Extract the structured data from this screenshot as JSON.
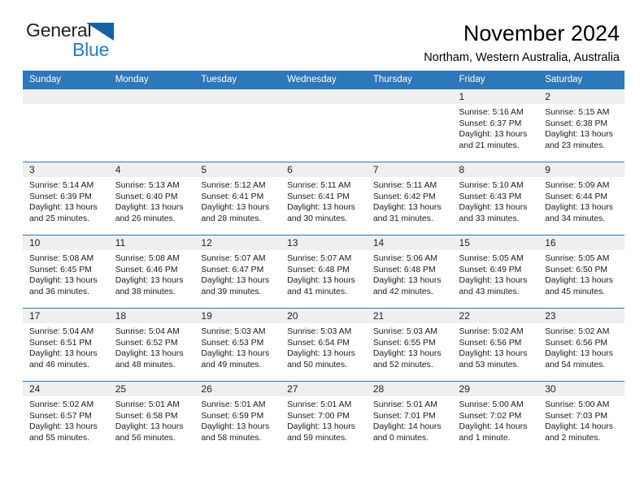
{
  "brand": {
    "word_general": "General",
    "word_blue": "Blue",
    "triangle_color": "#1464a5",
    "blue_text_color": "#1c7fd4"
  },
  "header": {
    "title": "November 2024",
    "location": "Northam, Western Australia, Australia"
  },
  "theme": {
    "header_blue": "#2e77b8",
    "daynum_band": "#efefef",
    "cell_background": "#ffffff",
    "text_color": "#1a1a1a"
  },
  "weekdays": [
    "Sunday",
    "Monday",
    "Tuesday",
    "Wednesday",
    "Thursday",
    "Friday",
    "Saturday"
  ],
  "labels": {
    "sunrise_prefix": "Sunrise:",
    "sunset_prefix": "Sunset:",
    "daylight_prefix": "Daylight:"
  },
  "weeks": [
    [
      {
        "day": "",
        "empty": true
      },
      {
        "day": "",
        "empty": true
      },
      {
        "day": "",
        "empty": true
      },
      {
        "day": "",
        "empty": true
      },
      {
        "day": "",
        "empty": true
      },
      {
        "day": "1",
        "sunrise": "Sunrise: 5:16 AM",
        "sunset": "Sunset: 6:37 PM",
        "daylight": "Daylight: 13 hours and 21 minutes."
      },
      {
        "day": "2",
        "sunrise": "Sunrise: 5:15 AM",
        "sunset": "Sunset: 6:38 PM",
        "daylight": "Daylight: 13 hours and 23 minutes."
      }
    ],
    [
      {
        "day": "3",
        "sunrise": "Sunrise: 5:14 AM",
        "sunset": "Sunset: 6:39 PM",
        "daylight": "Daylight: 13 hours and 25 minutes."
      },
      {
        "day": "4",
        "sunrise": "Sunrise: 5:13 AM",
        "sunset": "Sunset: 6:40 PM",
        "daylight": "Daylight: 13 hours and 26 minutes."
      },
      {
        "day": "5",
        "sunrise": "Sunrise: 5:12 AM",
        "sunset": "Sunset: 6:41 PM",
        "daylight": "Daylight: 13 hours and 28 minutes."
      },
      {
        "day": "6",
        "sunrise": "Sunrise: 5:11 AM",
        "sunset": "Sunset: 6:41 PM",
        "daylight": "Daylight: 13 hours and 30 minutes."
      },
      {
        "day": "7",
        "sunrise": "Sunrise: 5:11 AM",
        "sunset": "Sunset: 6:42 PM",
        "daylight": "Daylight: 13 hours and 31 minutes."
      },
      {
        "day": "8",
        "sunrise": "Sunrise: 5:10 AM",
        "sunset": "Sunset: 6:43 PM",
        "daylight": "Daylight: 13 hours and 33 minutes."
      },
      {
        "day": "9",
        "sunrise": "Sunrise: 5:09 AM",
        "sunset": "Sunset: 6:44 PM",
        "daylight": "Daylight: 13 hours and 34 minutes."
      }
    ],
    [
      {
        "day": "10",
        "sunrise": "Sunrise: 5:08 AM",
        "sunset": "Sunset: 6:45 PM",
        "daylight": "Daylight: 13 hours and 36 minutes."
      },
      {
        "day": "11",
        "sunrise": "Sunrise: 5:08 AM",
        "sunset": "Sunset: 6:46 PM",
        "daylight": "Daylight: 13 hours and 38 minutes."
      },
      {
        "day": "12",
        "sunrise": "Sunrise: 5:07 AM",
        "sunset": "Sunset: 6:47 PM",
        "daylight": "Daylight: 13 hours and 39 minutes."
      },
      {
        "day": "13",
        "sunrise": "Sunrise: 5:07 AM",
        "sunset": "Sunset: 6:48 PM",
        "daylight": "Daylight: 13 hours and 41 minutes."
      },
      {
        "day": "14",
        "sunrise": "Sunrise: 5:06 AM",
        "sunset": "Sunset: 6:48 PM",
        "daylight": "Daylight: 13 hours and 42 minutes."
      },
      {
        "day": "15",
        "sunrise": "Sunrise: 5:05 AM",
        "sunset": "Sunset: 6:49 PM",
        "daylight": "Daylight: 13 hours and 43 minutes."
      },
      {
        "day": "16",
        "sunrise": "Sunrise: 5:05 AM",
        "sunset": "Sunset: 6:50 PM",
        "daylight": "Daylight: 13 hours and 45 minutes."
      }
    ],
    [
      {
        "day": "17",
        "sunrise": "Sunrise: 5:04 AM",
        "sunset": "Sunset: 6:51 PM",
        "daylight": "Daylight: 13 hours and 46 minutes."
      },
      {
        "day": "18",
        "sunrise": "Sunrise: 5:04 AM",
        "sunset": "Sunset: 6:52 PM",
        "daylight": "Daylight: 13 hours and 48 minutes."
      },
      {
        "day": "19",
        "sunrise": "Sunrise: 5:03 AM",
        "sunset": "Sunset: 6:53 PM",
        "daylight": "Daylight: 13 hours and 49 minutes."
      },
      {
        "day": "20",
        "sunrise": "Sunrise: 5:03 AM",
        "sunset": "Sunset: 6:54 PM",
        "daylight": "Daylight: 13 hours and 50 minutes."
      },
      {
        "day": "21",
        "sunrise": "Sunrise: 5:03 AM",
        "sunset": "Sunset: 6:55 PM",
        "daylight": "Daylight: 13 hours and 52 minutes."
      },
      {
        "day": "22",
        "sunrise": "Sunrise: 5:02 AM",
        "sunset": "Sunset: 6:56 PM",
        "daylight": "Daylight: 13 hours and 53 minutes."
      },
      {
        "day": "23",
        "sunrise": "Sunrise: 5:02 AM",
        "sunset": "Sunset: 6:56 PM",
        "daylight": "Daylight: 13 hours and 54 minutes."
      }
    ],
    [
      {
        "day": "24",
        "sunrise": "Sunrise: 5:02 AM",
        "sunset": "Sunset: 6:57 PM",
        "daylight": "Daylight: 13 hours and 55 minutes."
      },
      {
        "day": "25",
        "sunrise": "Sunrise: 5:01 AM",
        "sunset": "Sunset: 6:58 PM",
        "daylight": "Daylight: 13 hours and 56 minutes."
      },
      {
        "day": "26",
        "sunrise": "Sunrise: 5:01 AM",
        "sunset": "Sunset: 6:59 PM",
        "daylight": "Daylight: 13 hours and 58 minutes."
      },
      {
        "day": "27",
        "sunrise": "Sunrise: 5:01 AM",
        "sunset": "Sunset: 7:00 PM",
        "daylight": "Daylight: 13 hours and 59 minutes."
      },
      {
        "day": "28",
        "sunrise": "Sunrise: 5:01 AM",
        "sunset": "Sunset: 7:01 PM",
        "daylight": "Daylight: 14 hours and 0 minutes."
      },
      {
        "day": "29",
        "sunrise": "Sunrise: 5:00 AM",
        "sunset": "Sunset: 7:02 PM",
        "daylight": "Daylight: 14 hours and 1 minute."
      },
      {
        "day": "30",
        "sunrise": "Sunrise: 5:00 AM",
        "sunset": "Sunset: 7:03 PM",
        "daylight": "Daylight: 14 hours and 2 minutes."
      }
    ]
  ]
}
